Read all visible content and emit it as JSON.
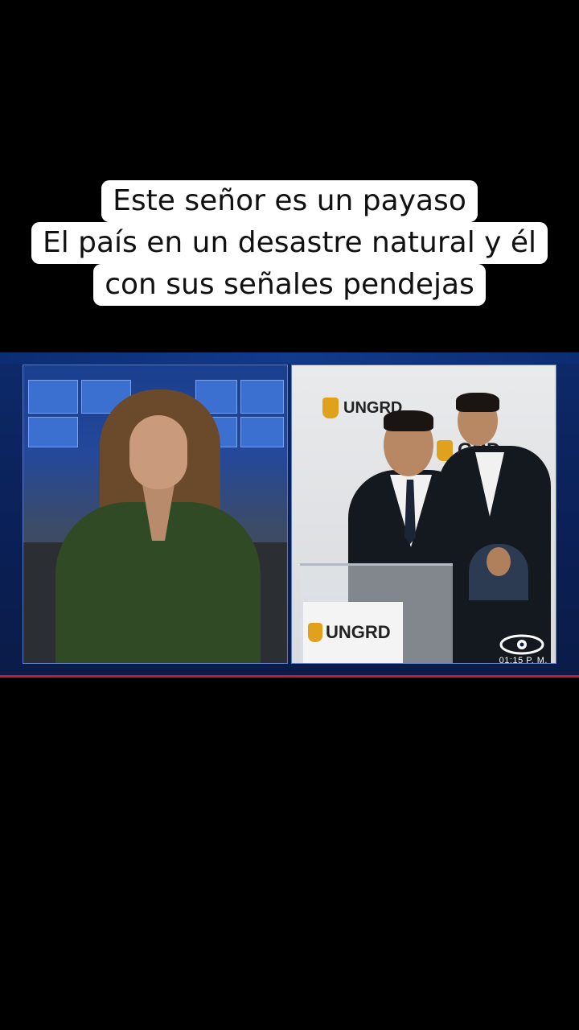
{
  "caption": {
    "line1": "Este señor es un payaso",
    "line2": "El país en un desastre natural y él",
    "line3": "con sus señales pendejas"
  },
  "broadcast": {
    "banner_logo": "UNGRD",
    "banner_logo_right": "GRD",
    "podium_logo": "UNGRD",
    "clock": "01:15 P. M.",
    "colors": {
      "frame": "#0a1f55",
      "accent_bar": "#c2183a"
    }
  },
  "icons": [
    "ungrd-hand-icon",
    "caracol-eye-logo-icon"
  ]
}
